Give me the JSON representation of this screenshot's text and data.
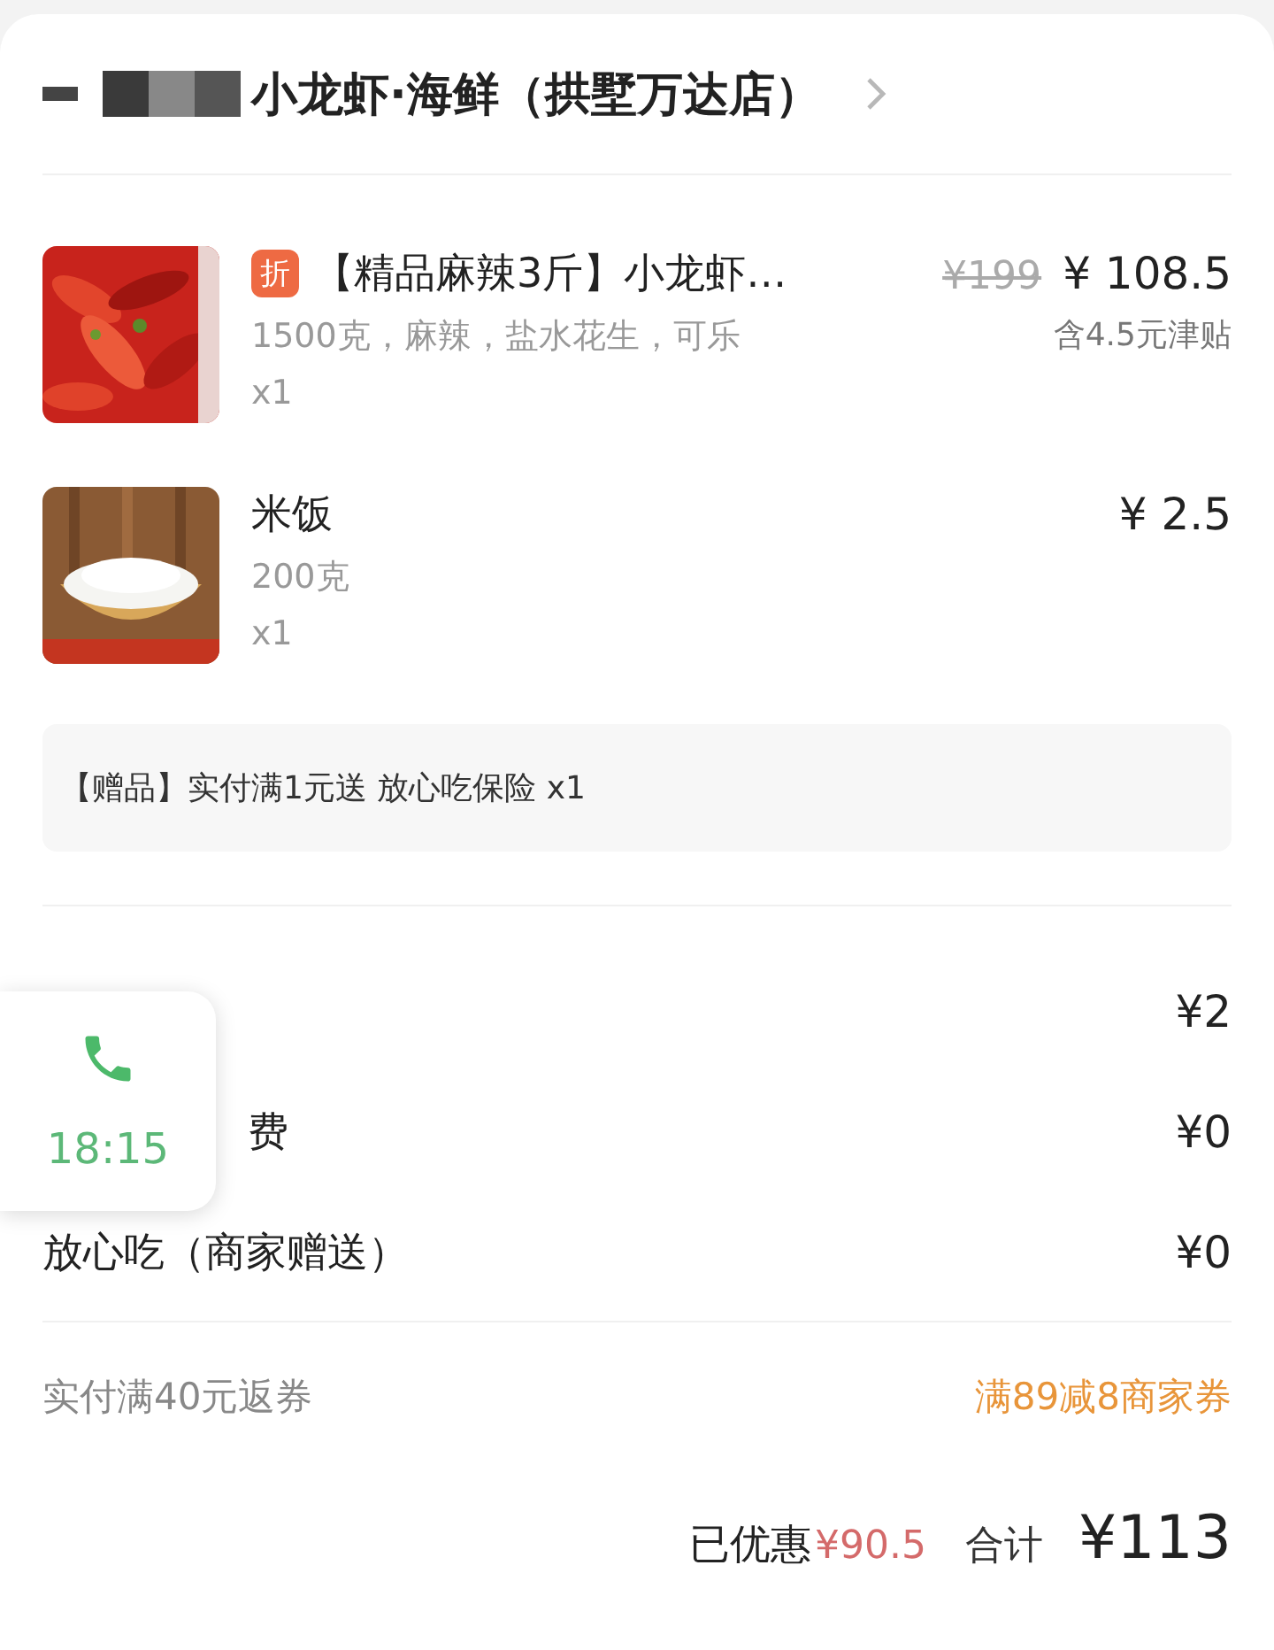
{
  "store": {
    "name": "小龙虾·海鲜（拱墅万达店）"
  },
  "items": [
    {
      "kind": "crayfish",
      "badge": "折",
      "name": "【精品麻辣3斤】小龙虾…",
      "original_price": "¥199",
      "price": "¥ 108.5",
      "specs": "1500克，麻辣，盐水花生，可乐",
      "subsidy": "含4.5元津贴",
      "quantity": "x1"
    },
    {
      "kind": "rice",
      "name": "米饭",
      "price": "¥ 2.5",
      "specs": "200克",
      "quantity": "x1"
    }
  ],
  "gift": "【赠品】实付满1元送 放心吃保险 x1",
  "fees": [
    {
      "amount": "¥2"
    },
    {
      "covered": true,
      "label": "费",
      "amount": "¥0"
    },
    {
      "covered": false,
      "label": "放心吃（商家赠送）",
      "amount": "¥0"
    }
  ],
  "coupon": {
    "rule": "实付满40元返券",
    "offer": "满89减8商家券"
  },
  "summary": {
    "discount_label": "已优惠",
    "discount": "¥90.5",
    "total_label": "合计",
    "total": "¥113"
  },
  "call_widget": {
    "time": "18:15"
  }
}
